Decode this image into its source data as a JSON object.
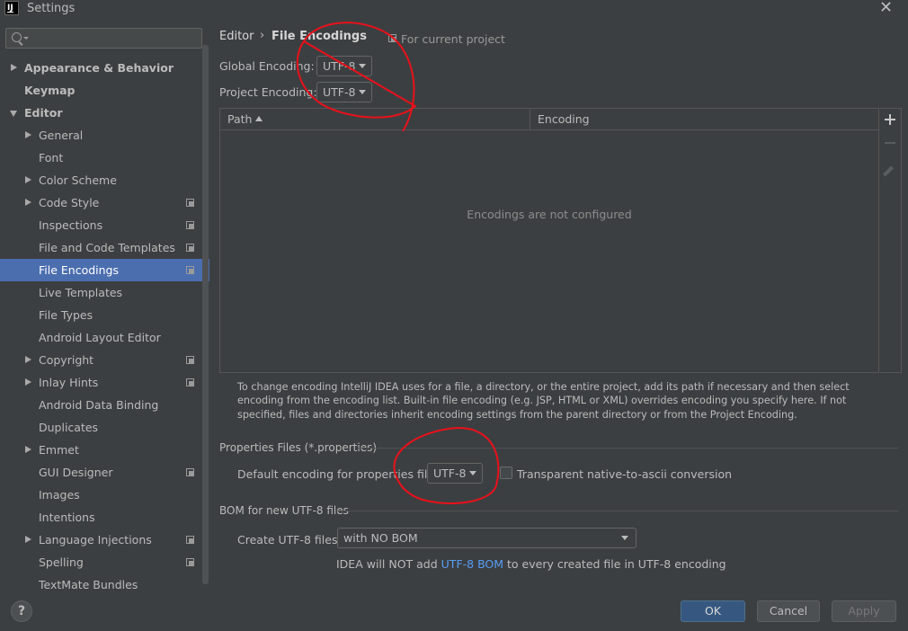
{
  "window": {
    "title": "Settings",
    "close_glyph": "✕",
    "logo_text": "IJ"
  },
  "sidebar": {
    "search": {
      "value": "",
      "placeholder": ""
    },
    "items": [
      {
        "label": "Appearance & Behavior",
        "level": 0,
        "expander": "collapsed",
        "bold": true
      },
      {
        "label": "Keymap",
        "level": 0,
        "expander": "none",
        "bold": true
      },
      {
        "label": "Editor",
        "level": 0,
        "expander": "expanded",
        "bold": true
      },
      {
        "label": "General",
        "level": 1,
        "expander": "collapsed"
      },
      {
        "label": "Font",
        "level": 1,
        "expander": "none"
      },
      {
        "label": "Color Scheme",
        "level": 1,
        "expander": "collapsed"
      },
      {
        "label": "Code Style",
        "level": 1,
        "expander": "collapsed",
        "scope_icon": true
      },
      {
        "label": "Inspections",
        "level": 1,
        "expander": "none",
        "scope_icon": true
      },
      {
        "label": "File and Code Templates",
        "level": 1,
        "expander": "none",
        "scope_icon": true
      },
      {
        "label": "File Encodings",
        "level": 1,
        "expander": "none",
        "scope_icon": true,
        "selected": true
      },
      {
        "label": "Live Templates",
        "level": 1,
        "expander": "none"
      },
      {
        "label": "File Types",
        "level": 1,
        "expander": "none"
      },
      {
        "label": "Android Layout Editor",
        "level": 1,
        "expander": "none"
      },
      {
        "label": "Copyright",
        "level": 1,
        "expander": "collapsed",
        "scope_icon": true
      },
      {
        "label": "Inlay Hints",
        "level": 1,
        "expander": "collapsed",
        "scope_icon": true
      },
      {
        "label": "Android Data Binding",
        "level": 1,
        "expander": "none"
      },
      {
        "label": "Duplicates",
        "level": 1,
        "expander": "none"
      },
      {
        "label": "Emmet",
        "level": 1,
        "expander": "collapsed"
      },
      {
        "label": "GUI Designer",
        "level": 1,
        "expander": "none",
        "scope_icon": true
      },
      {
        "label": "Images",
        "level": 1,
        "expander": "none"
      },
      {
        "label": "Intentions",
        "level": 1,
        "expander": "none"
      },
      {
        "label": "Language Injections",
        "level": 1,
        "expander": "collapsed",
        "scope_icon": true
      },
      {
        "label": "Spelling",
        "level": 1,
        "expander": "none",
        "scope_icon": true
      },
      {
        "label": "TextMate Bundles",
        "level": 1,
        "expander": "none"
      }
    ]
  },
  "main": {
    "breadcrumb": {
      "parent": "Editor",
      "separator": "›",
      "current": "File Encodings"
    },
    "scope_note": "For current project",
    "global_encoding": {
      "label": "Global Encoding:",
      "value": "UTF-8"
    },
    "project_encoding": {
      "label": "Project Encoding:",
      "value": "UTF-8"
    },
    "table": {
      "columns": [
        "Path",
        "Encoding"
      ],
      "empty_text": "Encodings are not configured"
    },
    "help_text": "To change encoding IntelliJ IDEA uses for a file, a directory, or the entire project, add its path if necessary and then select encoding from the encoding list. Built-in file encoding (e.g. JSP, HTML or XML) overrides encoding you specify here. If not specified, files and directories inherit encoding settings from the parent directory or from the Project Encoding.",
    "properties": {
      "section_title": "Properties Files (*.properties)",
      "default_label": "Default encoding for properties files:",
      "default_value": "UTF-8",
      "transparent_label": "Transparent native-to-ascii conversion",
      "transparent_checked": false
    },
    "bom": {
      "section_title": "BOM for new UTF-8 files",
      "create_label": "Create UTF-8 files:",
      "create_value": "with NO BOM",
      "info_prefix": "IDEA will NOT add ",
      "info_link": "UTF-8 BOM",
      "info_suffix": " to every created file in UTF-8 encoding"
    }
  },
  "footer": {
    "help_label": "?",
    "ok_label": "OK",
    "cancel_label": "Cancel",
    "apply_label": "Apply"
  },
  "colors": {
    "background": "#3c3f41",
    "selection": "#4b6eaf",
    "ok_button": "#365880",
    "link": "#589df6",
    "annotation": "#e8111b"
  }
}
